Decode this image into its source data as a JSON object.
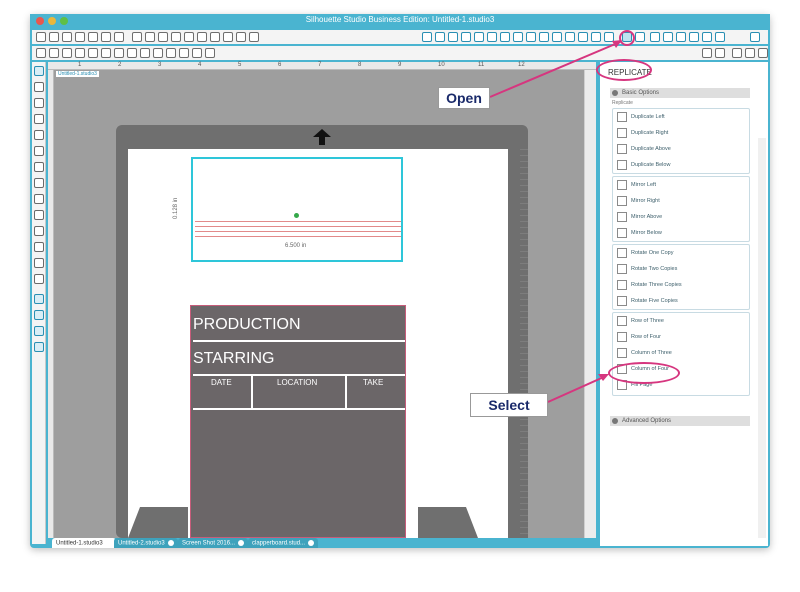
{
  "window": {
    "title": "Silhouette Studio Business Edition: Untitled-1.studio3"
  },
  "canvas": {
    "doc_tag": "Untitled-1.studio3",
    "ruler_labels": [
      "1",
      "2",
      "3",
      "4",
      "5",
      "6",
      "7",
      "8",
      "9",
      "10",
      "11",
      "12"
    ],
    "dimension_width": "6.500 in",
    "dimension_height": "0.128 in"
  },
  "clapperboard": {
    "production": "PRODUCTION",
    "starring": "STARRING",
    "date": "DATE",
    "location": "LOCATION",
    "take": "TAKE"
  },
  "tabs": [
    {
      "label": "Untitled-1.studio3"
    },
    {
      "label": "Untitled-2.studio3"
    },
    {
      "label": "Screen Shot 2016..."
    },
    {
      "label": "clapperboard.stud..."
    }
  ],
  "panel": {
    "title": "REPLICATE",
    "basic_options": "Basic Options",
    "replicate_sub": "Replicate",
    "advanced_options": "Advanced Options",
    "groups": [
      {
        "items": [
          "Duplicate Left",
          "Duplicate Right",
          "Duplicate Above",
          "Duplicate Below"
        ]
      },
      {
        "items": [
          "Mirror Left",
          "Mirror Right",
          "Mirror Above",
          "Mirror Below"
        ]
      },
      {
        "items": [
          "Rotate One Copy",
          "Rotate Two Copies",
          "Rotate Three Copies",
          "Rotate Five Copies"
        ]
      },
      {
        "items": [
          "Row of Three",
          "Row of Four",
          "Column of Three",
          "Column of Four",
          "Fill Page"
        ]
      }
    ]
  },
  "callouts": {
    "open": "Open",
    "select": "Select"
  },
  "colors": {
    "window_chrome": "#4ab4d0",
    "callout_pink": "#d6367f",
    "selection_cyan": "#2ec6d9",
    "clapper_gray": "#6b6668"
  }
}
